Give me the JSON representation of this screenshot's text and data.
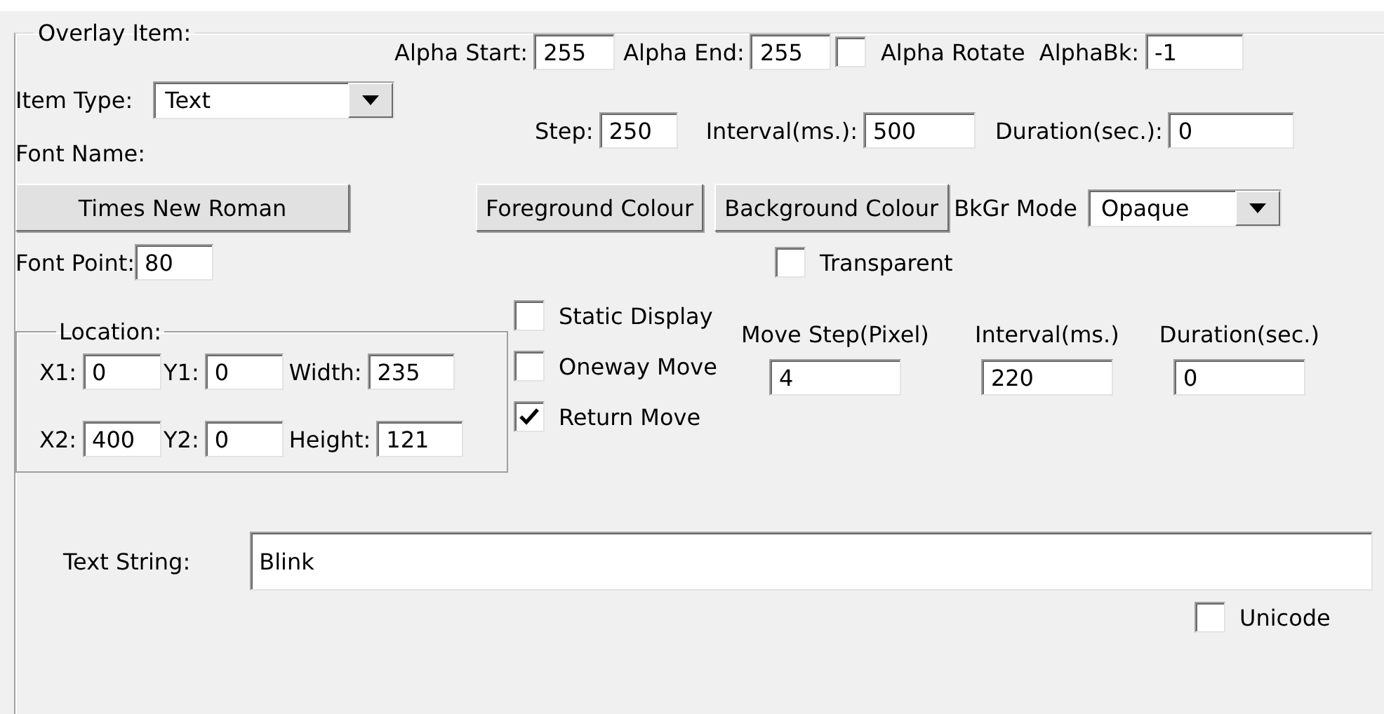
{
  "group_title": "Overlay Item:",
  "alpha": {
    "start_label": "Alpha Start:",
    "start": "255",
    "end_label": "Alpha End:",
    "end": "255",
    "rotate": {
      "label": "Alpha Rotate",
      "checked": false
    },
    "bk_label": "AlphaBk:",
    "bk": "-1"
  },
  "item_type": {
    "label": "Item Type:",
    "value": "Text"
  },
  "timing": {
    "step_label": "Step:",
    "step": "250",
    "interval_label": "Interval(ms.):",
    "interval": "500",
    "duration_label": "Duration(sec.):",
    "duration": "0"
  },
  "font": {
    "name_label": "Font Name:",
    "name_button": "Times New Roman",
    "point_label": "Font Point:",
    "point": "80"
  },
  "colour_buttons": [
    "Foreground Colour",
    "Background Colour"
  ],
  "bkgr_mode": {
    "label": "BkGr Mode",
    "value": "Opaque"
  },
  "transparent": {
    "label": "Transparent",
    "checked": false
  },
  "location": {
    "title": "Location:",
    "fields": [
      {
        "label": "X1:",
        "value": "0"
      },
      {
        "label": "Y1:",
        "value": "0"
      },
      {
        "label": "Width:",
        "value": "235"
      },
      {
        "label": "X2:",
        "value": "400"
      },
      {
        "label": "Y2:",
        "value": "0"
      },
      {
        "label": "Height:",
        "value": "121"
      }
    ]
  },
  "move_modes": [
    {
      "label": "Static Display",
      "checked": false
    },
    {
      "label": "Oneway Move",
      "checked": false
    },
    {
      "label": "Return Move",
      "checked": true
    }
  ],
  "move_fields": [
    {
      "label": "Move Step(Pixel)",
      "value": "4"
    },
    {
      "label": "Interval(ms.)",
      "value": "220"
    },
    {
      "label": "Duration(sec.)",
      "value": "0"
    }
  ],
  "text_string": {
    "label": "Text String:",
    "value": "Blink"
  },
  "unicode": {
    "label": "Unicode",
    "checked": false
  }
}
